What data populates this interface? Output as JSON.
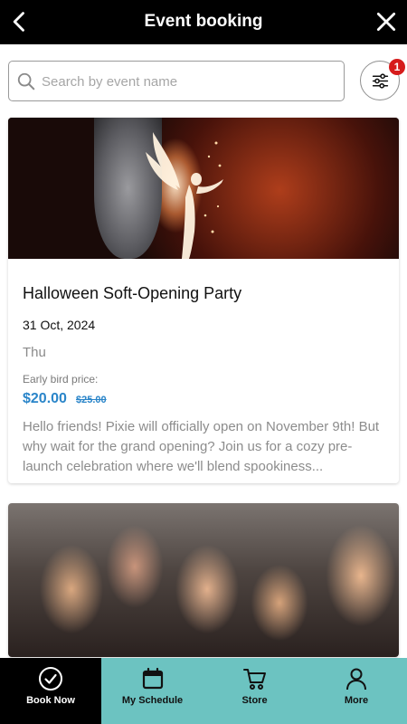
{
  "header": {
    "title": "Event booking",
    "back_icon": "chevron-left-icon",
    "close_icon": "close-icon"
  },
  "search": {
    "placeholder": "Search by event name",
    "value": "",
    "icon": "search-icon"
  },
  "filter": {
    "icon": "sliders-icon",
    "badge_count": "1"
  },
  "events": [
    {
      "title": "Halloween Soft-Opening Party",
      "date": "31 Oct, 2024",
      "day": "Thu",
      "early_bird_label": "Early bird price:",
      "price": "$20.00",
      "original_price": "$25.00",
      "description": "Hello friends! Pixie will officially open on November 9th! But why wait for the grand opening? Join us for a cozy pre-launch celebration where we'll blend spookiness..."
    },
    {
      "title": "",
      "image": "group-photo"
    }
  ],
  "nav": [
    {
      "label": "Book Now",
      "icon": "check-circle-icon",
      "active": true
    },
    {
      "label": "My Schedule",
      "icon": "calendar-icon",
      "active": false
    },
    {
      "label": "Store",
      "icon": "cart-icon",
      "active": false
    },
    {
      "label": "More",
      "icon": "user-icon",
      "active": false
    }
  ],
  "colors": {
    "header_bg": "#000000",
    "nav_bg": "#6cc3c1",
    "price": "#2a85c9",
    "badge": "#d61b1b"
  }
}
